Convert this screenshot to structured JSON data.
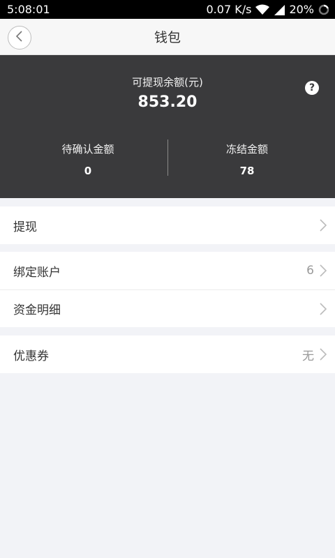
{
  "status_bar": {
    "time": "5:08:01",
    "speed": "0.07 K/s",
    "battery": "20%"
  },
  "header": {
    "title": "钱包"
  },
  "balance": {
    "available_label": "可提现余额(元)",
    "available_amount": "853.20",
    "help_label": "?",
    "pending_label": "待确认金额",
    "pending_value": "0",
    "frozen_label": "冻结金额",
    "frozen_value": "78"
  },
  "menu": {
    "withdraw": {
      "label": "提现"
    },
    "bound_account": {
      "label": "绑定账户",
      "value": "6"
    },
    "fund_details": {
      "label": "资金明细"
    },
    "coupons": {
      "label": "优惠券",
      "value": "无"
    }
  },
  "icons": {
    "back": "chevron-left-icon",
    "help": "question-icon",
    "chevron": "chevron-right-icon",
    "wifi": "wifi-icon",
    "signal": "signal-icon",
    "battery": "battery-ring-icon"
  },
  "colors": {
    "panel_bg": "#3a3a3c",
    "page_bg": "#f2f3f7"
  }
}
